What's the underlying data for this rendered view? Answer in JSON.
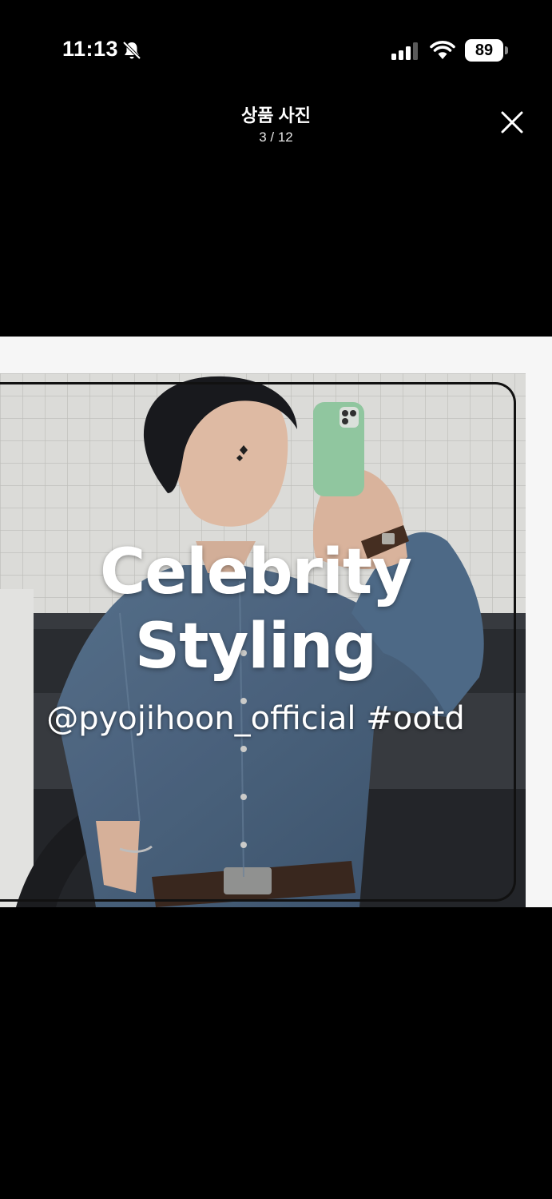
{
  "status_bar": {
    "time": "11:13",
    "battery": "89",
    "icons": [
      "bell-muted-icon",
      "cellular-signal-icon",
      "wifi-icon",
      "battery-icon"
    ]
  },
  "viewer": {
    "title": "상품 사진",
    "counter": "3 / 12",
    "close_icon": "close-icon"
  },
  "photo": {
    "line1": "Celebrity",
    "line2": "Styling",
    "line3": "@pyojihoon_official #ootd"
  },
  "colors": {
    "background": "#000000",
    "photo_bg": "#f6f6f6",
    "denim": "#4f6a86",
    "phone_case": "#9ad3a9"
  }
}
